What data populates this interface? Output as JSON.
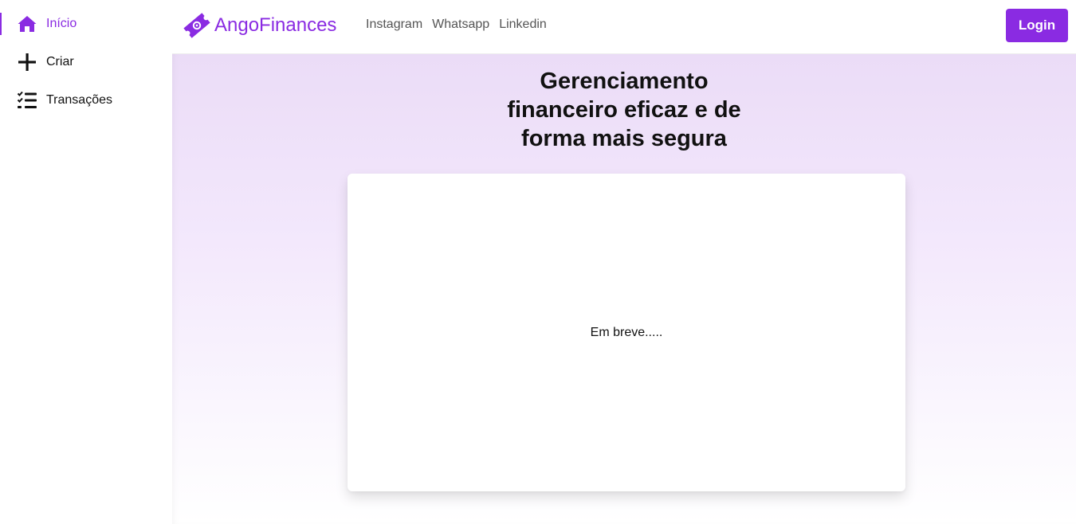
{
  "sidebar": {
    "items": [
      {
        "label": "Início",
        "icon": "home-icon",
        "active": true
      },
      {
        "label": "Criar",
        "icon": "plus-icon",
        "active": false
      },
      {
        "label": "Transações",
        "icon": "checklist-icon",
        "active": false
      }
    ]
  },
  "header": {
    "brand": "AngoFinances",
    "brand_icon": "ticket-logo-icon",
    "nav": [
      "Instagram",
      "Whatsapp",
      "Linkedin"
    ],
    "login_label": "Login"
  },
  "hero": {
    "title_lines": [
      "Gerenciamento",
      "financeiro eficaz e de",
      "forma mais segura"
    ]
  },
  "card": {
    "text": "Em breve....."
  },
  "colors": {
    "accent": "#8a2be2",
    "text": "#111111",
    "nav_text": "#555555",
    "background_top": "#ebdcf7"
  }
}
